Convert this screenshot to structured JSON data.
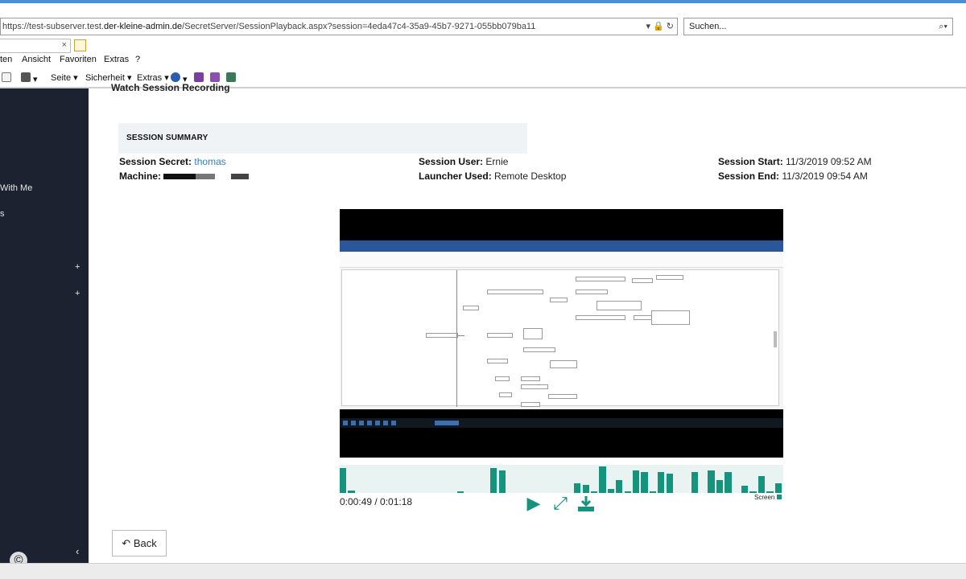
{
  "browser": {
    "address_prefix": "https://test-subserver.test.",
    "address_domain": "der-kleine-admin.de",
    "address_suffix": "/SecretServer/SessionPlayback.aspx?session=4eda47c4-35a9-45b7-9271-055bb079ba11",
    "address_icons": "▾ 🔒 ↻",
    "search_placeholder": "Suchen...",
    "search_icon": "⌕▾",
    "tab_close": "×",
    "menu": [
      "ten",
      "Ansicht",
      "Favoriten",
      "Extras",
      "?"
    ],
    "commands": {
      "page": "Seite ▾",
      "security": "Sicherheit ▾",
      "extras": "Extras ▾"
    }
  },
  "sidebar": {
    "items": [
      "With Me",
      "s"
    ],
    "plus": "+",
    "collapse": "‹"
  },
  "page": {
    "title": "Watch Session Recording",
    "summary_title": "SESSION SUMMARY",
    "secret_label": "Session Secret:",
    "secret_value": "thomas",
    "machine_label": "Machine:",
    "user_label": "Session User:",
    "user_value": "Ernie",
    "launcher_label": "Launcher Used:",
    "launcher_value": "Remote Desktop",
    "start_label": "Session Start:",
    "start_value": "11/3/2019 09:52 AM",
    "end_label": "Session End:",
    "end_value": "11/3/2019 09:54 AM"
  },
  "player": {
    "time_display": "0:00:49 / 0:01:18",
    "activity_levels": [
      0.9,
      0.1,
      0,
      0,
      0,
      0,
      0,
      0,
      0,
      0,
      0,
      0,
      0,
      0,
      0.05,
      0,
      0,
      0,
      0.9,
      0.8,
      0,
      0,
      0,
      0,
      0,
      0,
      0,
      0,
      0.35,
      0.3,
      0.05,
      0.95,
      0.15,
      0.45,
      0.05,
      0.8,
      0.75,
      0.05,
      0.75,
      0.7,
      0,
      0,
      0.75,
      0,
      0.8,
      0.45,
      0.75,
      0,
      0.25,
      0.05,
      0.6,
      0.05,
      0.35
    ],
    "screen_label": "Screen",
    "back_label": "Back"
  },
  "watermark": "©",
  "colors": {
    "accent": "#16937c",
    "sidebar": "#1c2230",
    "link": "#2a7fc9"
  }
}
